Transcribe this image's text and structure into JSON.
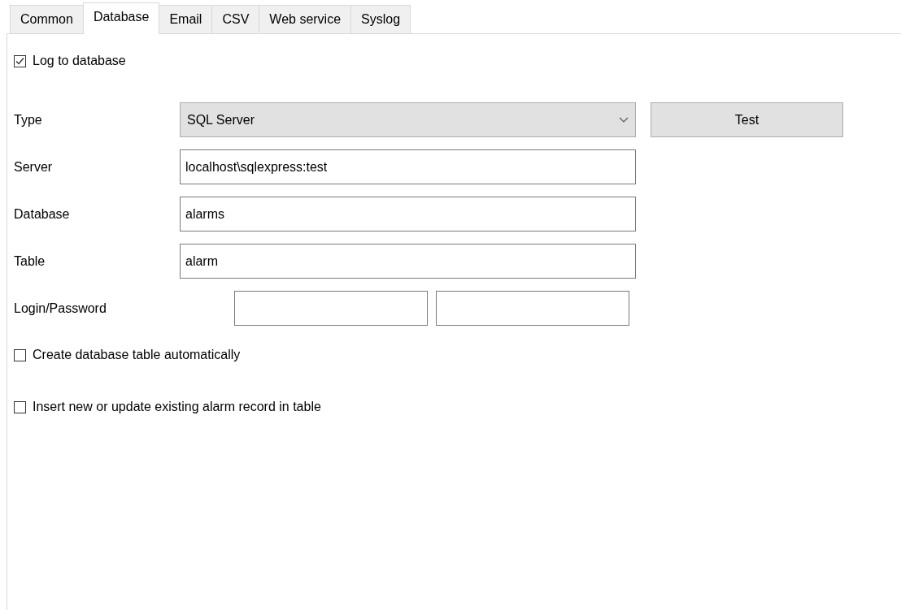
{
  "tabs": [
    {
      "label": "Common",
      "selected": false
    },
    {
      "label": "Database",
      "selected": true
    },
    {
      "label": "Email",
      "selected": false
    },
    {
      "label": "CSV",
      "selected": false
    },
    {
      "label": "Web service",
      "selected": false
    },
    {
      "label": "Syslog",
      "selected": false
    }
  ],
  "log_to_database": {
    "label": "Log to database",
    "checked": true
  },
  "fields": [
    {
      "kind": "combo",
      "label": "Type",
      "value": "SQL Server",
      "button": "Test"
    },
    {
      "kind": "text",
      "label": "Server",
      "value": "localhost\\sqlexpress:test"
    },
    {
      "kind": "text",
      "label": "Database",
      "value": "alarms"
    },
    {
      "kind": "text",
      "label": "Table",
      "value": "alarm"
    },
    {
      "kind": "pair",
      "label": "Login/Password"
    }
  ],
  "options": [
    {
      "label": "Create database table automatically",
      "checked": false
    },
    {
      "label": "Insert new or update existing alarm record in table",
      "checked": false
    }
  ]
}
